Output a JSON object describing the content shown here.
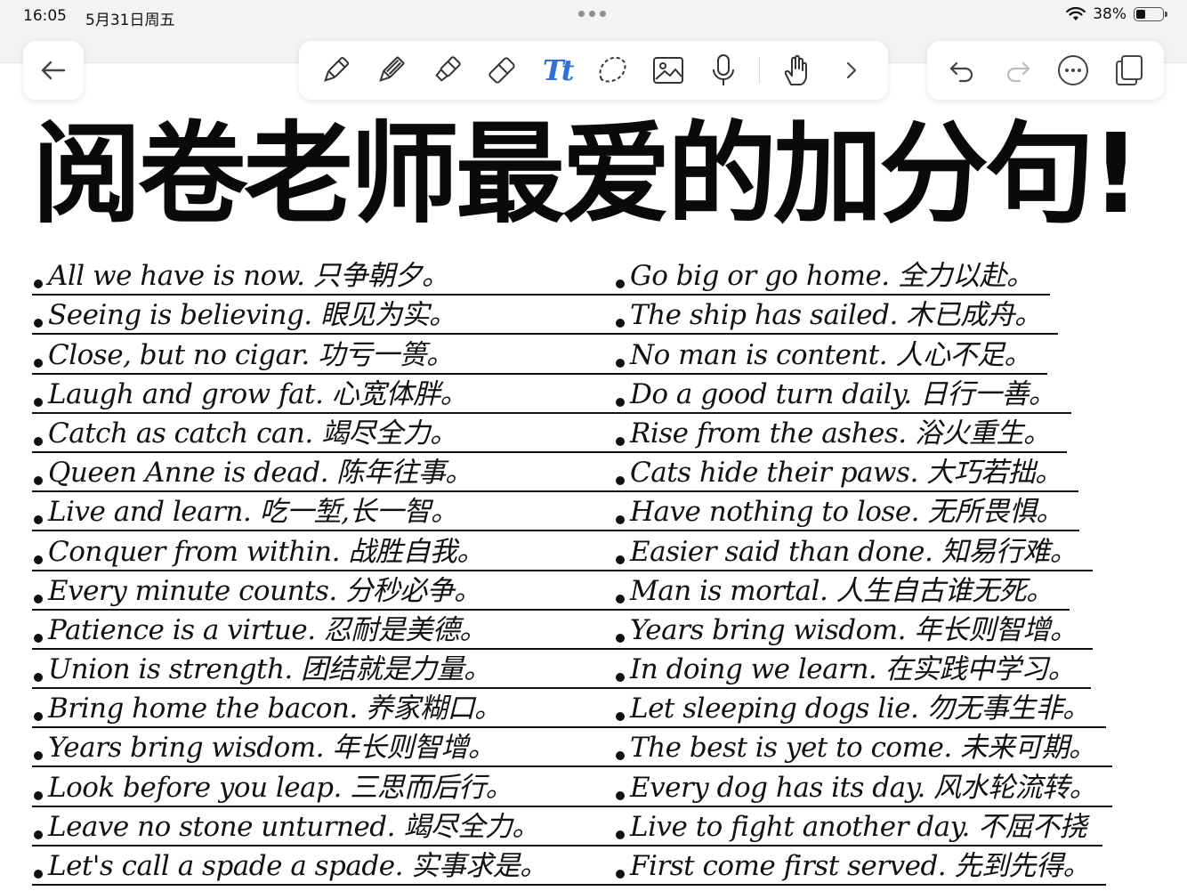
{
  "status_bar": {
    "time": "16:05",
    "date": "5月31日周五",
    "battery": "38%",
    "battery_level": 0.38
  },
  "toolbar": {
    "back_icon": "back-arrow-icon",
    "tools": [
      "pen-icon",
      "pencil-icon",
      "highlighter-icon",
      "eraser-icon",
      "text-tool-icon",
      "lasso-icon",
      "image-icon",
      "microphone-icon",
      "hand-touch-icon",
      "chevron-right-icon"
    ],
    "text_tool_label": "Tt",
    "text_tool_color": "#2f6fd6",
    "actions": [
      "undo-icon",
      "redo-icon",
      "more-icon",
      "pages-icon"
    ]
  },
  "page": {
    "title": "阅卷老师最爱的加分句!"
  },
  "phrases": {
    "left": [
      "All we have is now. 只争朝夕。",
      "Seeing is believing. 眼见为实。",
      "Close, but no cigar. 功亏一篑。",
      "Laugh and grow fat. 心宽体胖。",
      "Catch as catch can. 竭尽全力。",
      "Queen Anne is dead. 陈年往事。",
      "Live and learn. 吃一堑,长一智。",
      "Conquer from within. 战胜自我。",
      "Every minute counts. 分秒必争。",
      "Patience is a virtue. 忍耐是美德。",
      "Union is strength. 团结就是力量。",
      "Bring home the bacon. 养家糊口。",
      "Years bring wisdom. 年长则智增。",
      "Look before you leap. 三思而后行。",
      "Leave no stone unturned. 竭尽全力。",
      "Let's call a spade a spade. 实事求是。"
    ],
    "right": [
      "Go big or go home. 全力以赴。",
      "The ship has sailed. 木已成舟。",
      "No man is content. 人心不足。",
      "Do a good turn daily. 日行一善。",
      "Rise from the ashes. 浴火重生。",
      "Cats hide their paws. 大巧若拙。",
      "Have nothing to lose. 无所畏惧。",
      "Easier said than done. 知易行难。",
      "Man is mortal. 人生自古谁无死。",
      "Years bring wisdom. 年长则智增。",
      "In doing we learn. 在实践中学习。",
      "Let sleeping dogs lie. 勿无事生非。",
      "The best is yet to come. 未来可期。",
      "Every dog has its day. 风水轮流转。",
      "Live to fight another day. 不屈不挠",
      "First come first served. 先到先得。"
    ]
  }
}
